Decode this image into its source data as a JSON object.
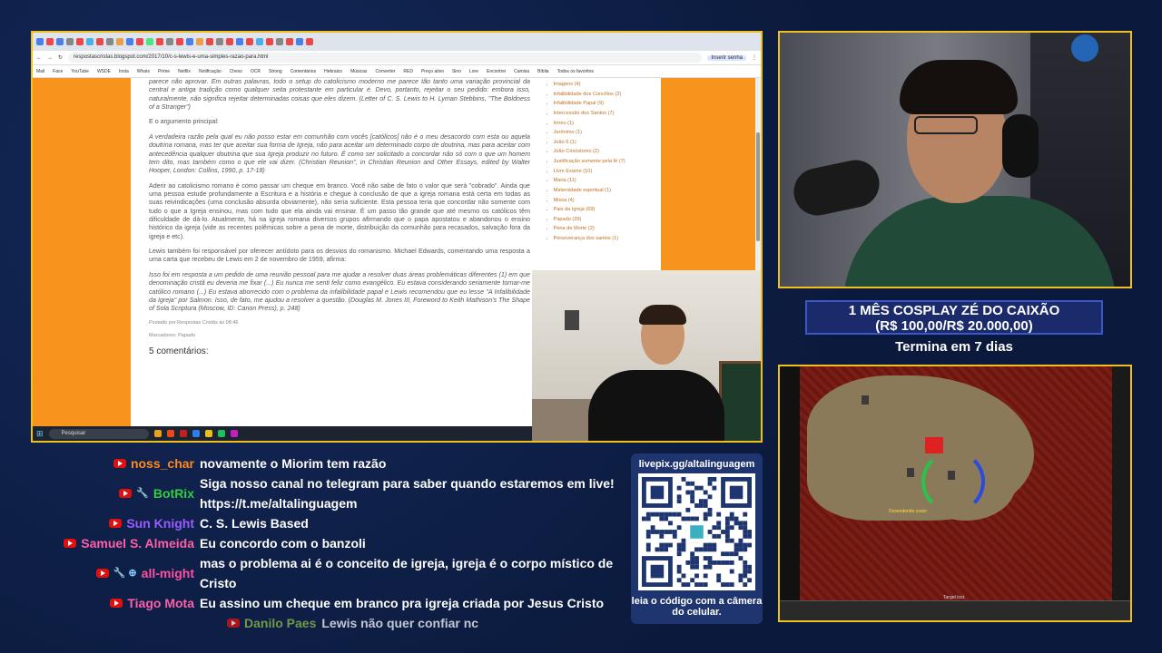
{
  "browser": {
    "url": "respostascristas.blogspot.com/2017/10/c-s-lewis-e-uma-simples-razao-para.html",
    "bookmarks": [
      "Mail",
      "Face",
      "YouTube",
      "WSDE",
      "Insta",
      "Whats",
      "Prime",
      "Netflix",
      "Notificação",
      "Chess",
      "OCR",
      "Strong",
      "Comentários",
      "Hebraico",
      "Músicas",
      "Converter",
      "RED",
      "Preço ativo",
      "Sino",
      "Lore",
      "Encontrei",
      "Camisa",
      "Bíblia",
      "Todos os favoritos"
    ],
    "profile_label": "Inserir senha",
    "taskbar_search": "Pesquisar"
  },
  "article": {
    "p1": "parece não aprovar. Em outras palavras, todo o setup do catolicismo moderno me parece tão tanto uma variação provincial da central e antiga tradição como qualquer seita protestante em particular é. Devo, portanto, rejeitar o seu pedido: embora isso, naturalmente, não significa rejeitar determinadas coisas que eles dizem. (Letter of C. S. Lewis to H. Lyman Stebbins, \"The Boldness of a Stranger\")",
    "p2": "E o argumento principal:",
    "p3": "A verdadeira razão pela qual eu não posso estar em comunhão com vocês [católicos] não é o meu desacordo com esta ou aquela doutrina romana, mas ter que aceitar sua forma de Igreja, não para aceitar um determinado corpo de doutrina, mas para aceitar com antecedência qualquer doutrina que sua Igreja produzir no futuro. É como ser solicitado a concordar não só com o que um homem tem dito, mas também como o que ele vai dizer. (Christian Reunion\", in Christian Reunion and Other Essays, edited by Walter Hooper, London: Collins, 1990, p. 17-18)",
    "p4": "Aderir ao catolicismo romano é como passar um cheque em branco. Você não sabe de fato o valor que será \"cobrado\". Ainda que uma pessoa estude profundamente a Escritura e a história e chegue à conclusão de que a igreja romana está certa em todas as suas reivindicações (uma conclusão absurda obviamente), não seria suficiente. Esta pessoa teria que concordar não somente com tudo o que a Igreja ensinou, mas com tudo que ela ainda vai ensinar. É um passo tão grande que até mesmo os católicos têm dificuldade de dá-lo. Atualmente, há na igreja romana diversos grupos afirmando que o papa apostatou e abandonou o ensino histórico da igreja (vide as recentes polêmicas sobre a pena de morte, distribuição da comunhão para recasados, salvação fora da igreja e etc).",
    "p5": "Lewis também foi responsável por oferecer antídoto para os desvios do romanismo. Michael Edwards, comentando uma resposta a uma carta que recebeu de Lewis em 2 de novembro de 1959, afirma:",
    "p6": "Isso foi em resposta a um pedido de uma reunião pessoal para me ajudar a resolver duas áreas problemáticas diferentes (1) em que denominação cristã eu deveria me fixar (...) Eu nunca me senti feliz como evangélico. Eu estava considerando seriamente tornar-me católico romano (...) Eu estava aborrecido com o problema da infalibilidade papal e Lewis recomendou que eu lesse \"A Infalibilidade da Igreja\" por Salmon. Isso, de fato, me ajudou a resolver a questão. (Douglas M. Jones III, Foreword to Keith Mathison's The Shape of Sola Scriptura (Moscow, ID: Canon Press), p. 248)",
    "posted": "Postado por Respostas Cristãs às 08:46",
    "labels": "Marcadores: Papado",
    "comments": "5 comentários:"
  },
  "sidebar": [
    "Imagens (4)",
    "Infalibilidade dos Concílios (2)",
    "Infalibilidade Papal (9)",
    "Intercessão dos Santos (7)",
    "Irineu (1)",
    "Jerônimo (1)",
    "João 6 (1)",
    "João Crisóstomo (2)",
    "Justificação somente pela fé (7)",
    "Livre Exame (10)",
    "Maria (11)",
    "Maternidade espiritual (1)",
    "Missa (4)",
    "Pais da Igreja (69)",
    "Papado (39)",
    "Pena de Morte (2)",
    "Perseverança dos santos (1)"
  ],
  "goal": {
    "title": "1 MÊS COSPLAY ZÉ DO CAIXÃO",
    "amount": "(R$ 100,00/R$ 20.000,00)",
    "footer": "Termina em 7 dias"
  },
  "qr": {
    "url": "livepix.gg/altalinguagem",
    "caption": "leia o código com a câmera do celular."
  },
  "chat": [
    {
      "user": "noss_char",
      "color": "#ff8a1e",
      "text": "novamente o Miorim tem razão",
      "badges": ""
    },
    {
      "user": "BotRix",
      "color": "#2fcf3f",
      "text": "Siga nosso canal no telegram para saber quando estaremos em live! https://t.me/altalinguagem",
      "badges": "🔧"
    },
    {
      "user": "Sun Knight",
      "color": "#9a5cff",
      "text": "C. S. Lewis Based",
      "badges": ""
    },
    {
      "user": "Samuel S. Almeida",
      "color": "#ff5fa8",
      "text": "Eu concordo com o banzoli",
      "badges": ""
    },
    {
      "user": "all-might",
      "color": "#ff4fa0",
      "text": "mas o problema ai é o conceito de igreja, igreja é o corpo místico de Cristo",
      "badges": "🔧 ⊕"
    },
    {
      "user": "Tiago Mota",
      "color": "#ff5fa8",
      "text": "Eu assino um cheque em branco pra igreja criada por Jesus Cristo",
      "badges": ""
    },
    {
      "user": "Danilo Paes",
      "color": "#8ec24a",
      "text": "Lewis não quer confiar nc",
      "badges": ""
    }
  ],
  "game": {
    "text1": "Dosendendo costo",
    "text2": "Target lost."
  }
}
